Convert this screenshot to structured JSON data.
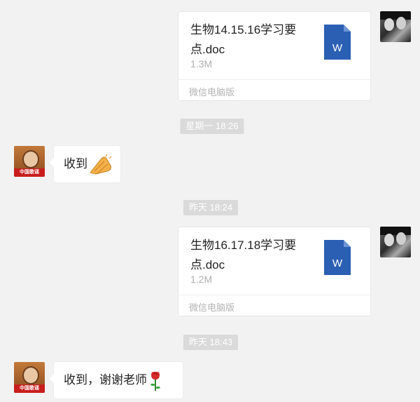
{
  "messages": [
    {
      "type": "file",
      "sender": "me",
      "file_name": "生物14.15.16学习要点.doc",
      "file_name_line1": "生物14.15.16学习要",
      "file_name_line2": "点.doc",
      "file_size": "1.3M",
      "source": "微信电脑版",
      "icon": "word-doc-icon",
      "icon_letter": "W"
    },
    {
      "type": "timestamp",
      "text": "星期一 18:26"
    },
    {
      "type": "text",
      "sender": "teacher",
      "text": "收到",
      "emoji": "applause-hands-emoji",
      "avatar_banner": "中国歌谣"
    },
    {
      "type": "timestamp",
      "text": "昨天 18:24"
    },
    {
      "type": "file",
      "sender": "me",
      "file_name": "生物16.17.18学习要点.doc",
      "file_name_line1": "生物16.17.18学习要",
      "file_name_line2": "点.doc",
      "file_size": "1.2M",
      "source": "微信电脑版",
      "icon": "word-doc-icon",
      "icon_letter": "W"
    },
    {
      "type": "timestamp",
      "text": "昨天 18:43"
    },
    {
      "type": "text",
      "sender": "teacher",
      "text": "收到，谢谢老师",
      "emoji": "rose-emoji",
      "avatar_banner": "中国歌谣"
    }
  ],
  "colors": {
    "background": "#f2f2f2",
    "bubble": "#ffffff",
    "timestamp_pill": "#dadada",
    "word_blue": "#2b5fb4"
  }
}
